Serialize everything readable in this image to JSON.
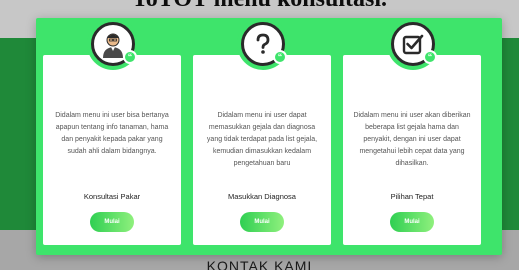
{
  "background": {
    "heading": "ToTOT menu konsultasi.",
    "footer_heading": "KONTAK KAMI"
  },
  "colors": {
    "modal": "#3ee46b",
    "page_band": "#28b04a",
    "button_start": "#2fcf52",
    "button_end": "#8ff07d",
    "icon_stroke": "#2a2a2a"
  },
  "cards": [
    {
      "icon": "expert-avatar-icon",
      "description": "Didalam menu ini user bisa bertanya apapun tentang info tanaman, hama dan penyakit kepada pakar yang sudah ahli dalam bidangnya.",
      "title": "Konsultasi Pakar",
      "button": "Mulai"
    },
    {
      "icon": "question-mark-icon",
      "description": "Didalam menu ini user dapat memasukkan gejala dan diagnosa yang tidak terdapat pada list gejala, kemudian dimasukkan kedalam pengetahuan baru",
      "title": "Masukkan Diagnosa",
      "button": "Mulai"
    },
    {
      "icon": "checkbox-icon",
      "description": "Didalam menu ini user akan diberikan beberapa list gejala hama dan penyakit, dengan ini user dapat mengetahui lebih cepat data yang dihasilkan.",
      "title": "Pilihan Tepat",
      "button": "Mulai"
    }
  ]
}
